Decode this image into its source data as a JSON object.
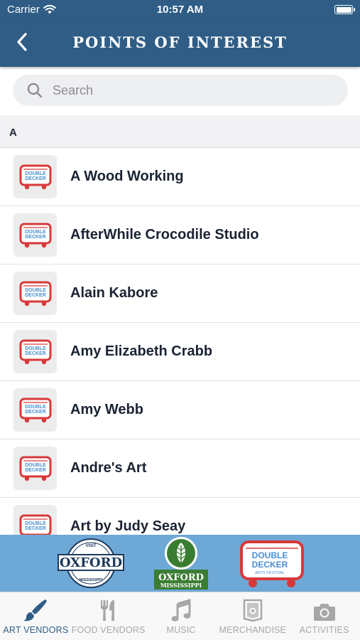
{
  "status_bar": {
    "carrier": "Carrier",
    "time": "10:57 AM"
  },
  "nav": {
    "title": "POINTS OF INTEREST",
    "back_icon": "chevron-left-icon"
  },
  "search": {
    "placeholder": "Search",
    "value": ""
  },
  "section": {
    "letter": "A"
  },
  "list_items": [
    {
      "label": "A Wood Working"
    },
    {
      "label": "AfterWhile Crocodile Studio"
    },
    {
      "label": "Alain Kabore"
    },
    {
      "label": "Amy Elizabeth Crabb"
    },
    {
      "label": "Amy Webb"
    },
    {
      "label": "Andre's Art"
    },
    {
      "label": "Art by Judy Seay"
    }
  ],
  "thumbnail_logo": {
    "line1": "DOUBLE",
    "line2": "DECKER"
  },
  "sponsors": [
    {
      "name": "OXFORD",
      "top_text": "VISIT",
      "bottom_text": "MISSISSIPPI"
    },
    {
      "line1": "OXFORD",
      "line2": "MISSISSIPPI"
    },
    {
      "line1": "DOUBLE",
      "line2": "DECKER",
      "line3": "ARTS FESTIVAL"
    }
  ],
  "tabs": [
    {
      "label": "ART VENDORS",
      "icon": "paintbrush-icon",
      "active": true
    },
    {
      "label": "FOOD VENDORS",
      "icon": "fork-knife-icon",
      "active": false
    },
    {
      "label": "MUSIC",
      "icon": "music-note-icon",
      "active": false
    },
    {
      "label": "MERCHANDISE",
      "icon": "badge-icon",
      "active": false
    },
    {
      "label": "ACTIVITIES",
      "icon": "camera-icon",
      "active": false
    }
  ],
  "colors": {
    "header": "#2f5d86",
    "sponsor_bar": "#6ea8d6",
    "logo_red": "#d9383a",
    "logo_blue": "#4a8fd0",
    "tab_active": "#2f5d86",
    "tab_inactive": "#a7a7a7"
  }
}
